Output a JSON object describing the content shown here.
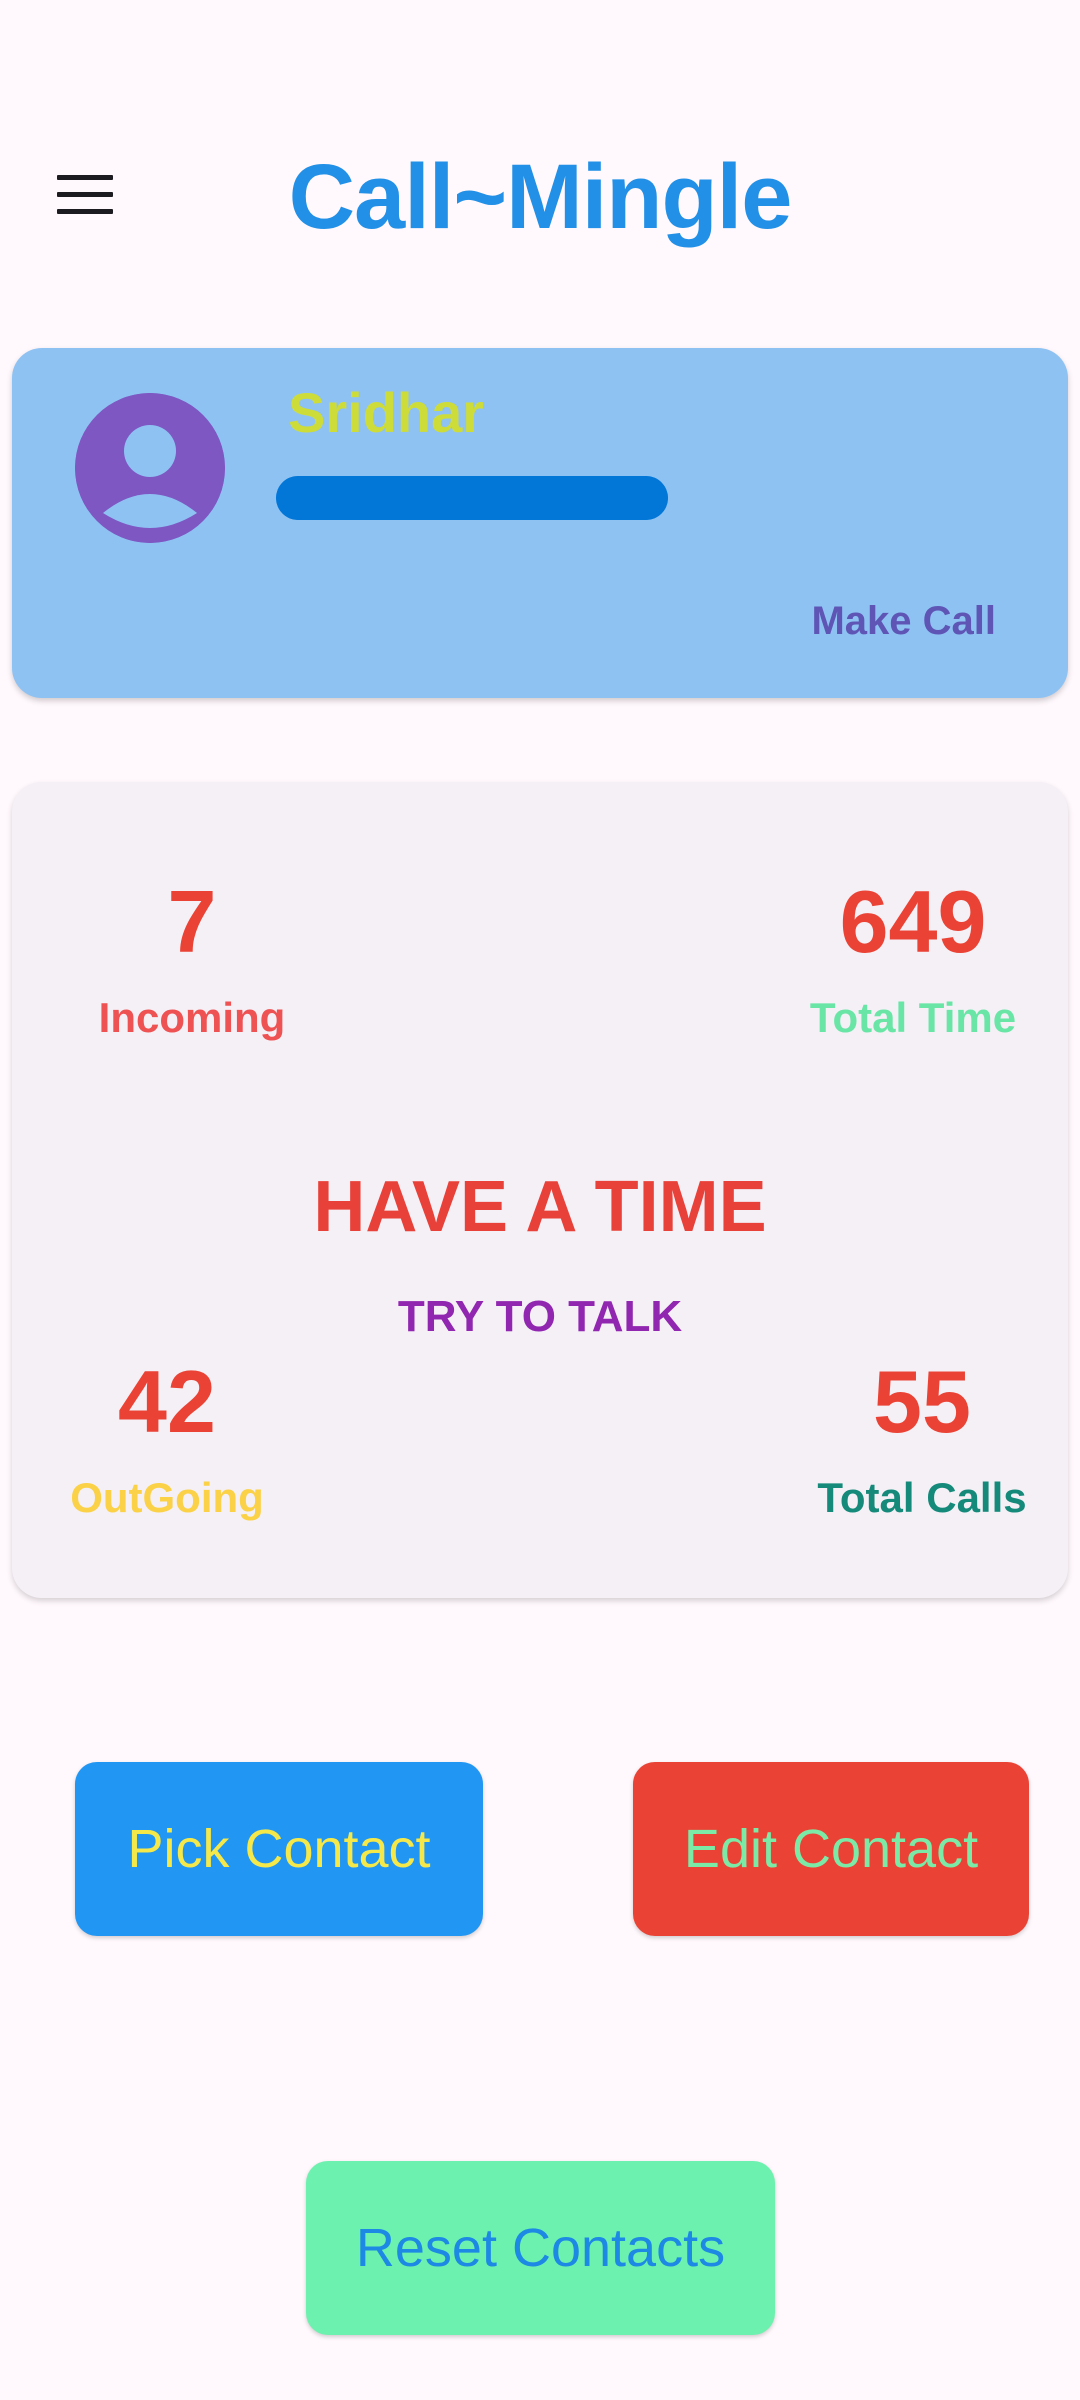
{
  "app_bar": {
    "title": "Call~Mingle",
    "menu_icon": "menu-icon"
  },
  "profile": {
    "name": "Sridhar",
    "avatar_icon": "person-avatar-icon",
    "progress": 1.0,
    "make_call_label": "Make Call"
  },
  "stats": {
    "incoming_value": "7",
    "incoming_label": "Incoming",
    "total_time_value": "649",
    "total_time_label": "Total Time",
    "tagline": "HAVE A TIME",
    "subtagline": "TRY TO TALK",
    "outgoing_value": "42",
    "outgoing_label": "OutGoing",
    "total_calls_value": "55",
    "total_calls_label": "Total Calls"
  },
  "actions": {
    "pick_contact_label": "Pick Contact",
    "edit_contact_label": "Edit Contact",
    "reset_contacts_label": "Reset Contacts"
  },
  "colors": {
    "primary": "#2290E6",
    "profile_card_bg": "#8EC2F3",
    "avatar_bg": "#7E57C2",
    "accent_red": "#EA4335",
    "stats_card_bg": "#F4F0F6",
    "pick_button_bg": "#2196F3",
    "edit_button_bg": "#EA4335",
    "reset_button_bg": "#6DF1AF"
  }
}
